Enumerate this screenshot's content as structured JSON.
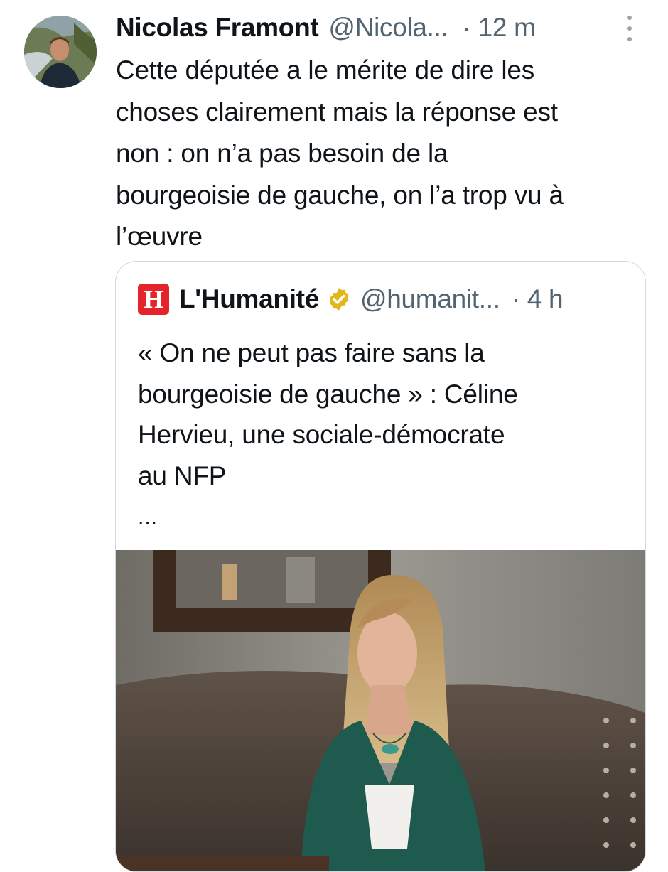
{
  "tweet": {
    "author_name": "Nicolas Framont",
    "author_handle": "@Nicola...",
    "time": "· 12 m",
    "text": "Cette députée a le mérite de dire les\nchoses clairement mais la réponse est\nnon : on n’a pas besoin de la\nbourgeoisie de gauche, on l’a trop vu à\nl’œuvre",
    "more_icon": "more-vertical-icon"
  },
  "quote": {
    "logo_letter": "H",
    "author_name": "L'Humanité",
    "verified_icon": "verified-gold-badge-icon",
    "author_handle": "@humanit...",
    "time": "· 4 h",
    "text": "« On ne peut pas faire sans la\nbourgeoisie de gauche » : Céline\nHervieu, une sociale-démocrate\nau NFP",
    "ellipsis": "...",
    "image_icon": "photo-woman-green-jacket"
  },
  "colors": {
    "text_primary": "#0f1419",
    "text_secondary": "#536471",
    "border": "#cfd9de",
    "humanite_red": "#e4232a",
    "verified_gold": "#e2b719"
  }
}
